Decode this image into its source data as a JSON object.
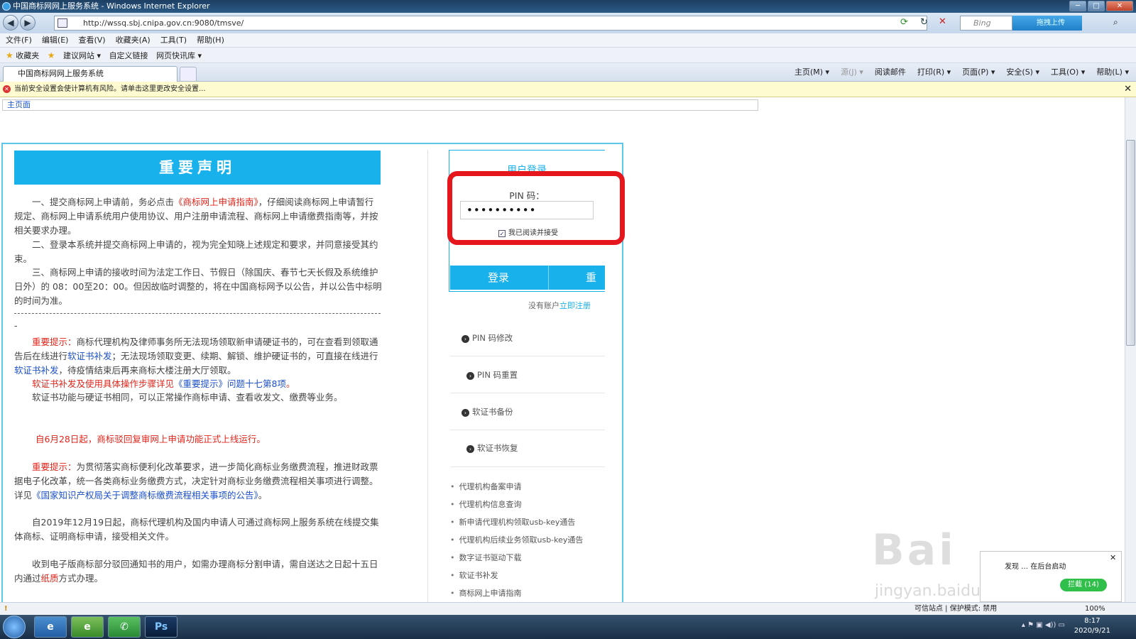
{
  "window": {
    "title": "中国商标网网上服务系统 - Windows Internet Explorer"
  },
  "address": {
    "url": "http://wssq.sbj.cnipa.gov.cn:9080/tmsve/",
    "search_placeholder": "Bing",
    "upload_label": "拖拽上传"
  },
  "menu": [
    "文件(F)",
    "编辑(E)",
    "查看(V)",
    "收藏夹(A)",
    "工具(T)",
    "帮助(H)"
  ],
  "favorites": {
    "label": "收藏夹",
    "items": [
      "建议网站 ▾",
      "自定义链接",
      "网页快讯库 ▾"
    ]
  },
  "tab": {
    "label": "中国商标网网上服务系统"
  },
  "commands": [
    "主页(M) ▾",
    "源(J) ▾",
    "阅读邮件",
    "打印(R) ▾",
    "页面(P) ▾",
    "安全(S) ▾",
    "工具(O) ▾",
    "帮助(L) ▾"
  ],
  "infobar": {
    "text": "当前安全设置会使计算机有风险。请单击这里更改安全设置..."
  },
  "inner": {
    "home_link": "主页面"
  },
  "notice": {
    "heading": "重要声明",
    "p1a": "一、提交商标网上申请前，务必点击",
    "p1link": "《商标网上申请指南》",
    "p1b": "，仔细阅读商标网上申请暂行规定、商标网上申请系统用户使用协议、用户注册申请流程、商标网上申请缴费指南等，并按相关要求办理。",
    "p2": "二、登录本系统并提交商标网上申请的，视为完全知晓上述规定和要求，并同意接受其约束。",
    "p3": "三、商标网上申请的接收时间为法定工作日、节假日（除国庆、春节七天长假及系统维护日外）的 08：00至20：00。但因故临时调整的，将在中国商标网予以公告，并以公告中标明的时间为准。",
    "dash_tail": "-",
    "tip1_label": "重要提示：",
    "tip1a": "商标代理机构及律师事务所无法现场领取新申请硬证书的，可在查看到领取通告后在线进行",
    "tip1link1": "软证书补发",
    "tip1b": "；无法现场领取变更、续期、解锁、维护硬证书的，可直接在线进行",
    "tip1link2": "软证书补发",
    "tip1c": "，待疫情结束后再来商标大楼注册大厅领取。",
    "tip1d_red": "软证书补发及使用具体操作步骤详见",
    "tip1d_blue": "《重要提示》问题十七第8项",
    "tip1d_end": "。",
    "tip1e": "软证书功能与硬证书相同，可以正常操作商标申请、查看收发文、缴费等业务。",
    "red_line": "自6月28日起，商标驳回复审网上申请功能正式上线运行。",
    "tip2_label": "重要提示：",
    "tip2a": "为贯彻落实商标便利化改革要求，进一步简化商标业务缴费流程，推进财政票据电子化改革，统一各类商标业务缴费方式，决定针对商标业务缴费流程相关事项进行调整。详见",
    "tip2link": "《国家知识产权局关于调整商标缴费流程相关事项的公告》",
    "tip2end": "。",
    "p4": "自2019年12月19日起，商标代理机构及国内申请人可通过商标网上服务系统在线提交集体商标、证明商标申请，接受相关文件。",
    "p5a": "收到电子版商标部分驳回通知书的用户，如需办理商标分割申请，需自送达之日起十五日内通过",
    "p5red": "纸质",
    "p5b": "方式办理。"
  },
  "login": {
    "title": "用户登录",
    "pin_label": "PIN 码：",
    "pin_value": "••••••••••",
    "agree_label": "我已阅读并接受",
    "login_button": "登录",
    "reset_button": "重置",
    "no_account": "没有账户",
    "register_link": "立即注册",
    "actions": [
      "PIN 码修改",
      "PIN 码重置",
      "软证书备份",
      "软证书恢复"
    ],
    "links": [
      "代理机构备案申请",
      "代理机构信息查询",
      "新申请代理机构领取usb-key通告",
      "代理机构后续业务领取usb-key通告",
      "数字证书驱动下载",
      "软证书补发",
      "商标网上申请指南"
    ]
  },
  "status": {
    "zone": "可信站点 | 保护模式: 禁用",
    "zoom": "100%"
  },
  "taskbar": {
    "ps_label": "Ps",
    "time": "8:17",
    "date": "2020/9/21"
  },
  "popup": {
    "text_a": "发现",
    "text_b": "在后台启动",
    "block_button": "拦截 (14)"
  },
  "watermark": {
    "big": "Bai",
    "small": "jingyan.baidu.com"
  }
}
